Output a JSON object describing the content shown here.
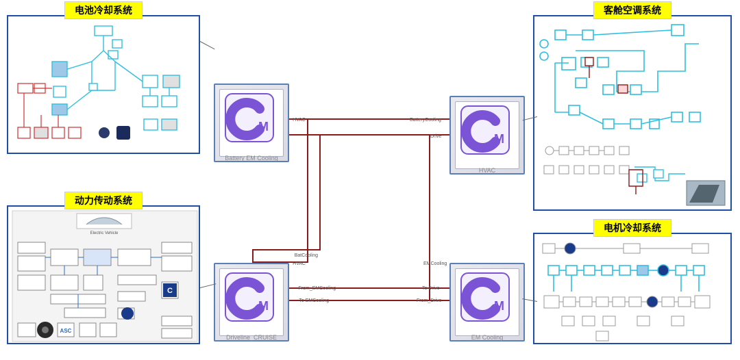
{
  "panels": {
    "battery_cooling": {
      "title": "电池冷却系统"
    },
    "driveline": {
      "title": "动力传动系统",
      "vehicle_label": "Electric Vehicle"
    },
    "hvac_cabin": {
      "title": "客舱空调系统"
    },
    "em_cooling": {
      "title": "电机冷却系统"
    }
  },
  "center": {
    "blocks": {
      "battery_cooling": {
        "label": "Battery EM Cooling"
      },
      "hvac": {
        "label": "HVAC"
      },
      "driveline": {
        "label": "Driveline_CRUISE"
      },
      "em_cooling": {
        "label": "EM Cooling"
      }
    },
    "ports": {
      "tl_hvac": "HVAC",
      "tl_to_tr": "BatteryCooling",
      "tr_drive": "Drive",
      "bl_batcool": "BatCooling",
      "bl_hvac": "HVAC",
      "bl_from_em": "From_EMCooling",
      "bl_to_em": "To EMCooling",
      "br_to_drive": "To Drive",
      "br_from_drive": "From_Drive",
      "br_em": "EMCooling"
    }
  },
  "colors": {
    "panel_border": "#1f4ea8",
    "label_bg": "#ffff00",
    "cm_purple": "#7a54d4",
    "wire": "#8b1a1a",
    "schematic_cyan": "#2fbfe0"
  }
}
